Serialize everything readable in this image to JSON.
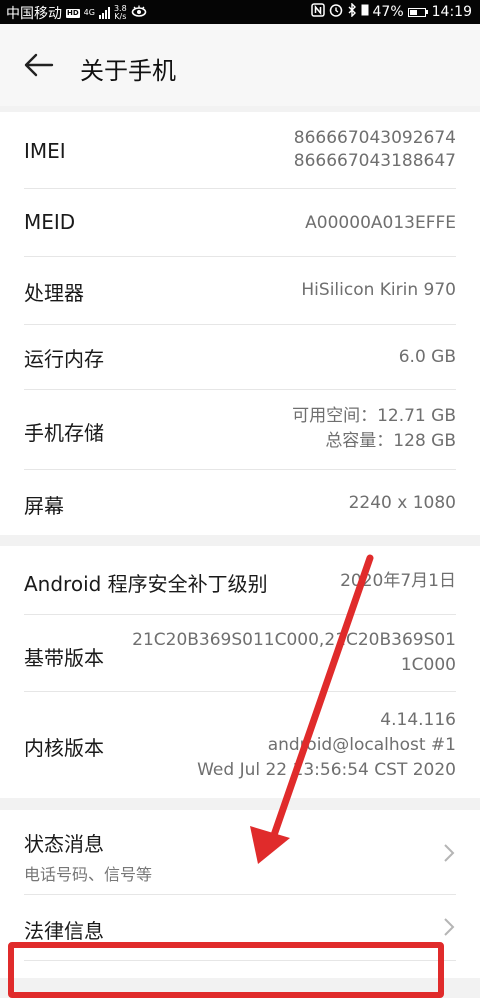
{
  "status_bar": {
    "carrier": "中国移动",
    "hd": "HD",
    "network": "4G",
    "speed_value": "3.8",
    "speed_unit": "K/s",
    "battery_percent": "47%",
    "time": "14:19"
  },
  "header": {
    "title": "关于手机"
  },
  "section1": {
    "imei_label": "IMEI",
    "imei_value_1": "866667043092674",
    "imei_value_2": "866667043188647",
    "meid_label": "MEID",
    "meid_value": "A00000A013EFFE",
    "cpu_label": "处理器",
    "cpu_value": "HiSilicon Kirin 970",
    "ram_label": "运行内存",
    "ram_value": "6.0 GB",
    "storage_label": "手机存储",
    "storage_available": "可用空间：12.71  GB",
    "storage_total": "总容量：128  GB",
    "screen_label": "屏幕",
    "screen_value": "2240 x 1080"
  },
  "section2": {
    "patch_label": "Android 程序安全补丁级别",
    "patch_value": "2020年7月1日",
    "baseband_label": "基带版本",
    "baseband_line1": "21C20B369S011C000,21C20B369S01",
    "baseband_line2": "1C000",
    "kernel_label": "内核版本",
    "kernel_line1": "4.14.116",
    "kernel_line2": "android@localhost #1",
    "kernel_line3": "Wed Jul 22 13:56:54 CST 2020"
  },
  "section3": {
    "status_label": "状态消息",
    "status_sub": "电话号码、信号等",
    "legal_label": "法律信息"
  },
  "annotation_color": "#e02b2b"
}
